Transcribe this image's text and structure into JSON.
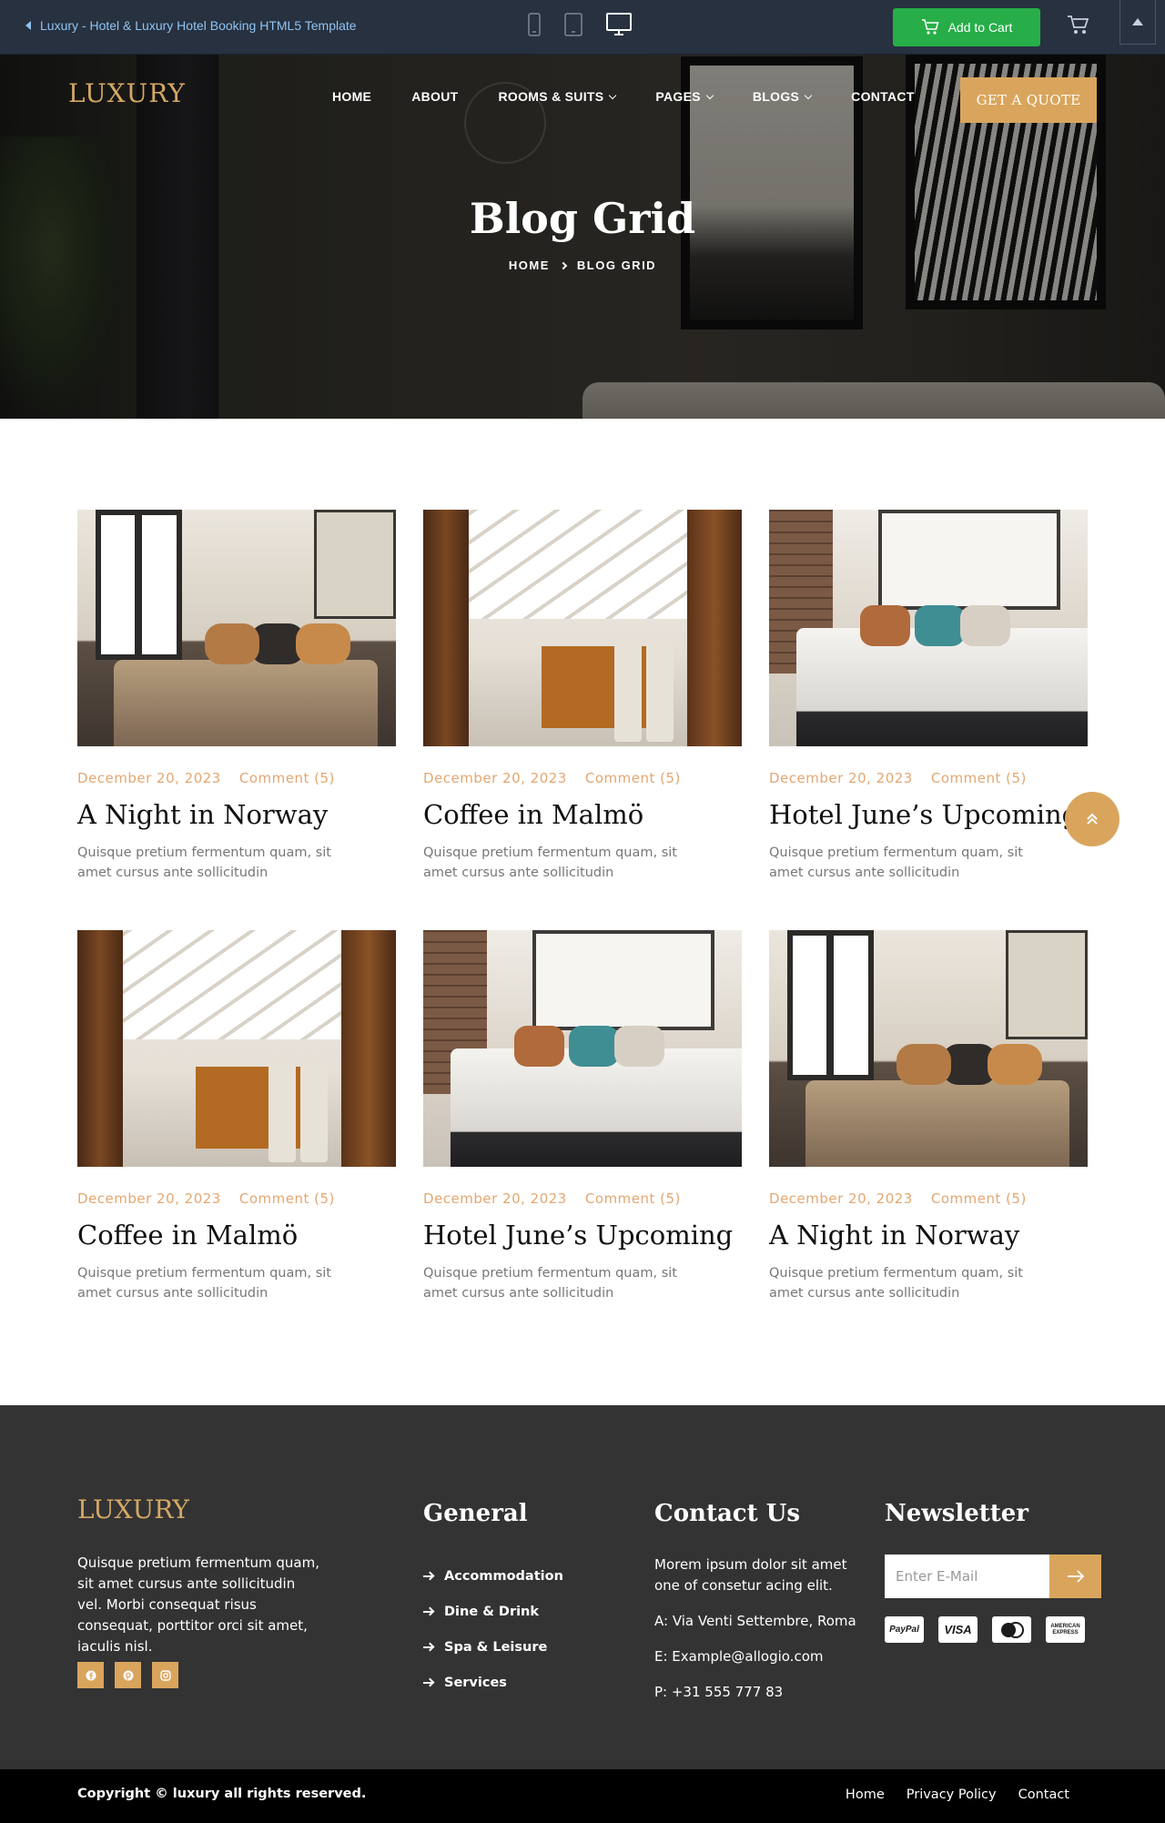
{
  "preview_bar": {
    "title": "Luxury - Hotel & Luxury Hotel Booking HTML5 Template",
    "add_to_cart": "Add to Cart",
    "colors": {
      "background": "#273140",
      "cart_button": "#27ae48",
      "link": "#8fc3f0"
    }
  },
  "header": {
    "logo": "LUXURY",
    "nav": [
      {
        "label": "HOME",
        "dropdown": false
      },
      {
        "label": "ABOUT",
        "dropdown": false
      },
      {
        "label": "ROOMS & SUITS",
        "dropdown": true
      },
      {
        "label": "PAGES",
        "dropdown": true
      },
      {
        "label": "BLOGS",
        "dropdown": true
      },
      {
        "label": "CONTACT",
        "dropdown": false
      }
    ],
    "cta": "GET A QUOTE"
  },
  "hero": {
    "title": "Blog Grid",
    "breadcrumb": {
      "home": "HOME",
      "current": "BLOG GRID"
    }
  },
  "posts": [
    {
      "date": "December 20, 2023",
      "comments": "Comment (5)",
      "title": "A Night in Norway",
      "excerpt": "Quisque pretium fermentum quam, sit amet cursus ante sollicitudin",
      "image": "bedroom-window"
    },
    {
      "date": "December 20, 2023",
      "comments": "Comment (5)",
      "title": "Coffee in Malmö",
      "excerpt": "Quisque pretium fermentum quam, sit amet cursus ante sollicitudin",
      "image": "attic-dining"
    },
    {
      "date": "December 20, 2023",
      "comments": "Comment (5)",
      "title": "Hotel June’s Upcoming",
      "excerpt": "Quisque pretium fermentum quam, sit amet cursus ante sollicitudin",
      "image": "loft-bedroom"
    },
    {
      "date": "December 20, 2023",
      "comments": "Comment (5)",
      "title": "Coffee in Malmö",
      "excerpt": "Quisque pretium fermentum quam, sit amet cursus ante sollicitudin",
      "image": "attic-dining"
    },
    {
      "date": "December 20, 2023",
      "comments": "Comment (5)",
      "title": "Hotel June’s Upcoming",
      "excerpt": "Quisque pretium fermentum quam, sit amet cursus ante sollicitudin",
      "image": "loft-bedroom"
    },
    {
      "date": "December 20, 2023",
      "comments": "Comment (5)",
      "title": "A Night in Norway",
      "excerpt": "Quisque pretium fermentum quam, sit amet cursus ante sollicitudin",
      "image": "bedroom-window"
    }
  ],
  "footer": {
    "logo": "LUXURY",
    "about": "Quisque pretium fermentum quam, sit amet cursus ante sollicitudin vel. Morbi consequat risus consequat, porttitor orci sit amet, iaculis nisl.",
    "socials": [
      "facebook-icon",
      "pinterest-icon",
      "instagram-icon"
    ],
    "general": {
      "title": "General",
      "links": [
        "Accommodation",
        "Dine & Drink",
        "Spa & Leisure",
        "Services"
      ]
    },
    "contact": {
      "title": "Contact Us",
      "intro": "Morem ipsum dolor sit amet one of consetur acing elit.",
      "address": "A: Via Venti Settembre, Roma",
      "email": "E: Example@allogio.com",
      "phone": "P: +31 555 777 83"
    },
    "newsletter": {
      "title": "Newsletter",
      "placeholder": "Enter E-Mail",
      "payments": [
        "PayPal",
        "VISA",
        "mastercard",
        "AMERICAN EXPRESS"
      ]
    },
    "copyright": "Copyright © luxury all rights reserved.",
    "bottom_links": [
      "Home",
      "Privacy Policy",
      "Contact"
    ]
  },
  "colors": {
    "accent": "#d9a55d",
    "meta": "#e3a771",
    "footer_bg": "#333333",
    "bottom_bar": "#000000"
  }
}
